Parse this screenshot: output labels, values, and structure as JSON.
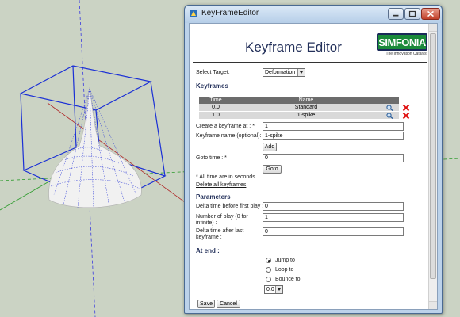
{
  "window": {
    "title": "KeyFrameEditor"
  },
  "header": {
    "title": "Keyframe Editor",
    "logo_text": "SIMFONIA",
    "logo_tagline": "The Innovation Catalyst"
  },
  "target": {
    "label": "Select Target:",
    "value": "Deformation"
  },
  "keyframes": {
    "heading": "Keyframes",
    "columns": [
      "Time",
      "Name"
    ],
    "rows": [
      {
        "time": "0.0",
        "name": "Standard"
      },
      {
        "time": "1.0",
        "name": "1-spike"
      }
    ]
  },
  "create": {
    "at_label": "Create a keyframe at : *",
    "at_value": "1",
    "name_label": "Keyframe name (optional):",
    "name_value": "1-spike",
    "add_button": "Add"
  },
  "goto": {
    "label": "Goto time : *",
    "value": "0",
    "button": "Goto"
  },
  "notes": {
    "seconds": "* All time are in seconds",
    "delete_all": "Delete all keyframes"
  },
  "parameters": {
    "heading": "Parameters",
    "delta_first_label": "Delta time before first play :",
    "delta_first_value": "0",
    "num_play_label": "Number of play (0 for infinite) :",
    "num_play_value": "1",
    "delta_last_label": "Delta time after last keyframe :",
    "delta_last_value": "0"
  },
  "at_end": {
    "heading": "At end :",
    "options": [
      "Jump to",
      "Loop to",
      "Bounce to"
    ],
    "selected": "Jump to",
    "time_value": "0.0"
  },
  "footer": {
    "save": "Save",
    "cancel": "Cancel"
  },
  "colors": {
    "title_blue": "#23305a",
    "bbox_blue": "#1a2fd6",
    "table_header": "#6c6c6c",
    "delete_red": "#e01010"
  }
}
